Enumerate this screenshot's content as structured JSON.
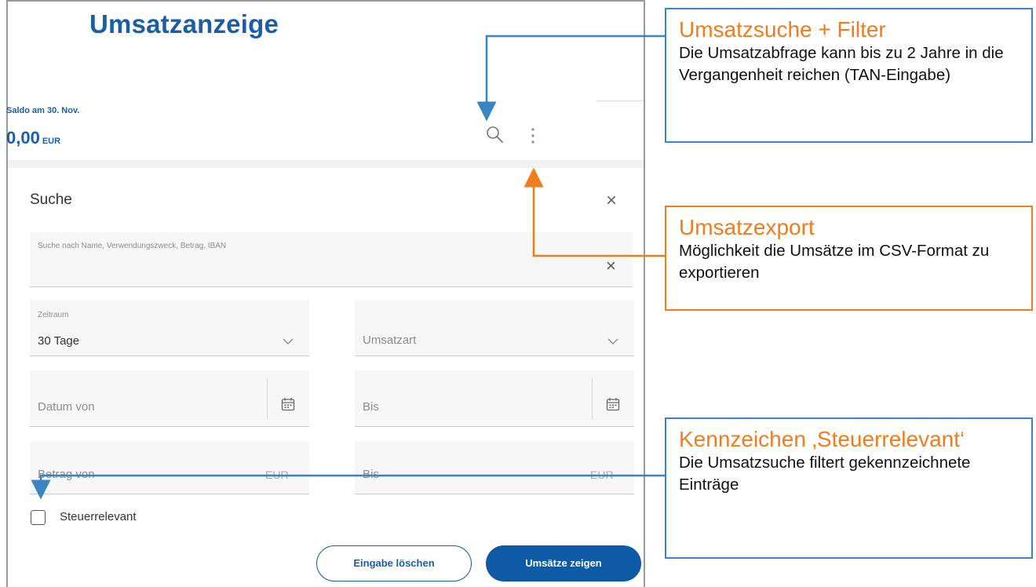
{
  "page": {
    "title": "Umsatzanzeige",
    "saldo_label": "Saldo am 30. Nov.",
    "saldo_value": "0,00",
    "saldo_currency": "EUR"
  },
  "search": {
    "title": "Suche",
    "query_placeholder": "Suche nach Name, Verwendungszweck, Betrag, IBAN",
    "zeitraum_label": "Zeitraum",
    "zeitraum_value": "30 Tage",
    "umsatzart_placeholder": "Umsatzart",
    "datum_von_placeholder": "Datum von",
    "datum_bis_placeholder": "Bis",
    "betrag_von_placeholder": "Betrag von",
    "betrag_bis_placeholder": "Bis",
    "currency": "EUR",
    "checkbox_label": "Steuerrelevant",
    "checkbox_checked": false,
    "reset_button": "Eingabe löschen",
    "submit_button": "Umsätze zeigen"
  },
  "callouts": {
    "filter": {
      "title": "Umsatzsuche + Filter",
      "body": "Die Umsatzabfrage kann bis zu 2 Jahre in die Vergangenheit reichen (TAN-Eingabe)"
    },
    "export": {
      "title": "Umsatzexport",
      "body": "Möglichkeit die Umsätze im CSV-Format zu exportieren"
    },
    "steuer": {
      "title": "Kennzeichen ‚Steuerrelevant‘",
      "body": "Die Umsatzsuche filtert gekennzeichnete Einträge"
    }
  },
  "colors": {
    "brand_blue": "#1a5ea8",
    "button_blue": "#0f5aa6",
    "callout_orange": "#f07c1c",
    "callout_blue": "#3a84c3"
  },
  "icons": [
    "search-icon",
    "more-vertical-icon",
    "close-icon",
    "chevron-down-icon",
    "calendar-icon"
  ]
}
